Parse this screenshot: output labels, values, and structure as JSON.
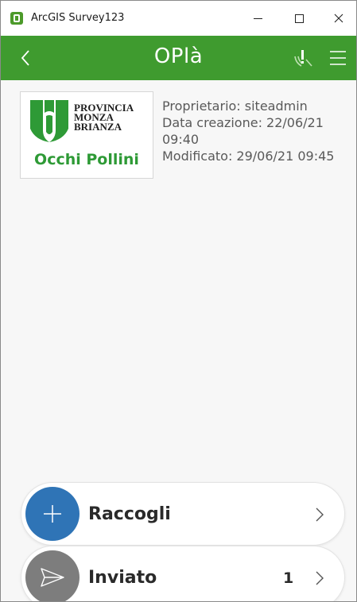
{
  "window": {
    "title": "ArcGIS Survey123",
    "controls": {
      "minimize": "minimize",
      "maximize": "maximize",
      "close": "close"
    }
  },
  "header": {
    "title": "OPlà",
    "background": "#3f9b2f",
    "icons": {
      "back": "chevron-left-icon",
      "sensor": "gps-warning-icon",
      "menu": "hamburger-menu-icon"
    }
  },
  "survey": {
    "thumbnail": {
      "logo_lines": [
        "PROVINCIA",
        "MONZA",
        "BRIANZA"
      ],
      "brand_name": "Occhi Pollini"
    },
    "owner": "Proprietario: siteadmin",
    "created": "Data creazione: 22/06/21 09:40",
    "modified": "Modificato: 29/06/21 09:45"
  },
  "actions": [
    {
      "label": "Raccogli",
      "icon": "plus-icon",
      "color": "#2f74b6",
      "count": ""
    },
    {
      "label": "Inviato",
      "icon": "send-icon",
      "color": "#7d7d7d",
      "count": "1"
    }
  ]
}
